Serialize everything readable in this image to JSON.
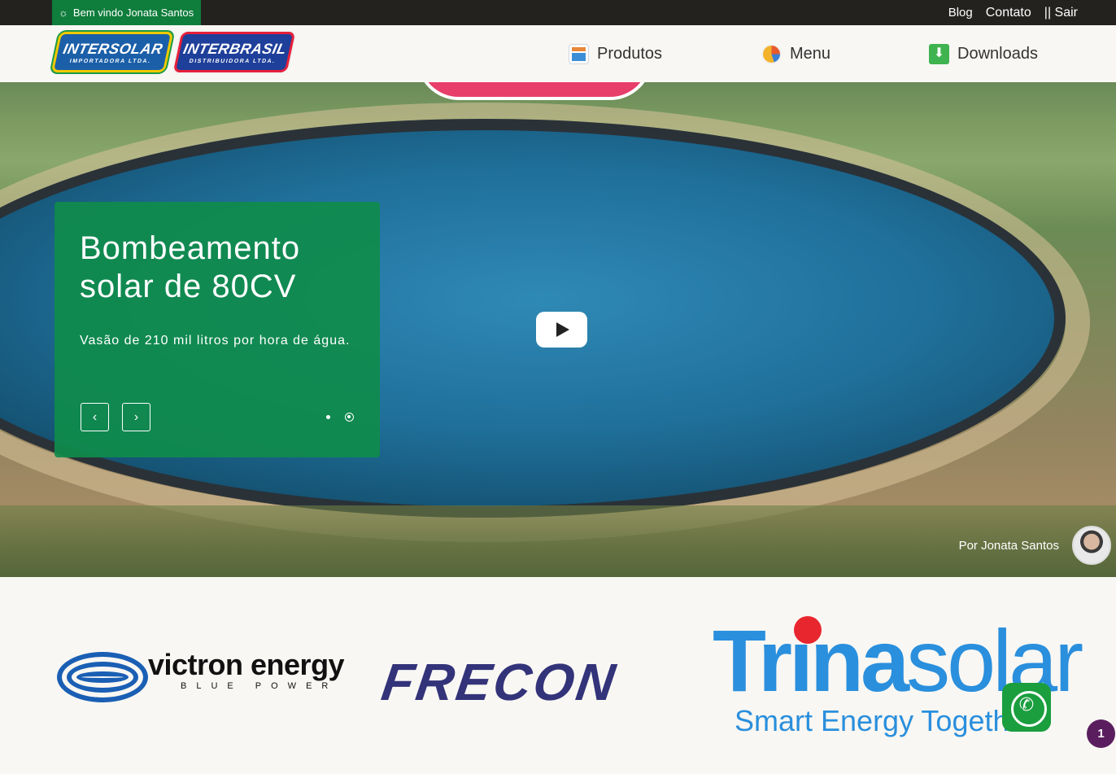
{
  "topbar": {
    "welcome_text": "Bem vindo Jonata Santos",
    "links": {
      "blog": "Blog",
      "contato": "Contato",
      "sair": "|| Sair"
    }
  },
  "header": {
    "logos": {
      "intersolar": {
        "name": "INTERSOLAR",
        "sub": "IMPORTADORA LTDA."
      },
      "interbrasil": {
        "name": "INTERBRASIL",
        "sub": "DISTRIBUIDORA LTDA."
      }
    },
    "nav": [
      {
        "label": "Produtos",
        "icon": "grid-icon"
      },
      {
        "label": "Menu",
        "icon": "pie-chart-icon"
      },
      {
        "label": "Downloads",
        "icon": "download-icon"
      }
    ]
  },
  "hero": {
    "title": "Bombeamento solar de 80CV",
    "text": "Vasão de 210 mil litros por hora de água.",
    "prev_label": "‹",
    "next_label": "›",
    "slides_total": 2,
    "active_slide": 2,
    "author": "Por Jonata Santos"
  },
  "brands": {
    "victron": {
      "name": "victron energy",
      "tag": "BLUE POWER"
    },
    "frecon": {
      "name": "FRECON"
    },
    "trina": {
      "name_bold": "Trina",
      "name_light": "solar",
      "tag": "Smart Energy Together"
    }
  },
  "notification_count": "1",
  "colors": {
    "topbar": "#24221f",
    "welcome_bg": "#0f7d3c",
    "card_bg": "#0f8c4b",
    "whatsapp": "#1a9e3e",
    "badge": "#5a1e5f"
  }
}
